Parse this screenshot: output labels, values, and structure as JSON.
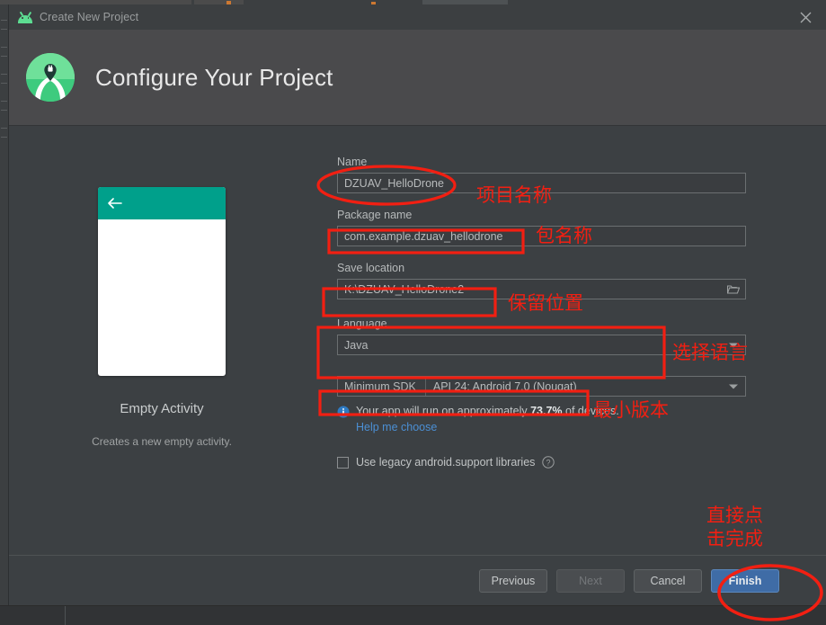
{
  "window": {
    "title": "Create New Project",
    "icon": "android-robot-icon",
    "close_label": "×"
  },
  "header": {
    "title": "Configure Your Project",
    "logo": "android-studio-logo"
  },
  "preview": {
    "template_name": "Empty Activity",
    "template_description": "Creates a new empty activity.",
    "appbar_color": "#00a08b",
    "back_icon": "back-arrow-icon"
  },
  "form": {
    "name": {
      "label": "Name",
      "value": "DZUAV_HelloDrone"
    },
    "package_name": {
      "label": "Package name",
      "value": "com.example.dzuav_hellodrone"
    },
    "save_location": {
      "label": "Save location",
      "value": "K:\\DZUAV_HelloDrone2",
      "browse_icon": "folder-icon"
    },
    "language": {
      "label": "Language",
      "value": "Java",
      "caret_icon": "chevron-down-icon"
    },
    "minimum_sdk": {
      "label": "Minimum SDK",
      "value": "API 24: Android 7.0 (Nougat)",
      "caret_icon": "chevron-down-icon"
    },
    "device_info": {
      "icon": "info-icon",
      "text_before": "Your app will run on approximately ",
      "percent": "73.7%",
      "text_after": " of devices.",
      "help_link": "Help me choose"
    },
    "legacy_checkbox": {
      "label": "Use legacy android.support libraries",
      "checked": false,
      "help_icon": "question-mark-icon"
    }
  },
  "footer": {
    "previous": "Previous",
    "next": "Next",
    "cancel": "Cancel",
    "finish": "Finish"
  },
  "annotations": {
    "accent_color": "#f21f12",
    "notes": [
      {
        "id": "note-name",
        "text": "项目名称"
      },
      {
        "id": "note-package",
        "text": "包名称"
      },
      {
        "id": "note-location",
        "text": "保留位置"
      },
      {
        "id": "note-language",
        "text": "选择语言"
      },
      {
        "id": "note-sdk",
        "text": "最小版本"
      },
      {
        "id": "note-finish",
        "text": "直接点\n击完成"
      }
    ]
  }
}
